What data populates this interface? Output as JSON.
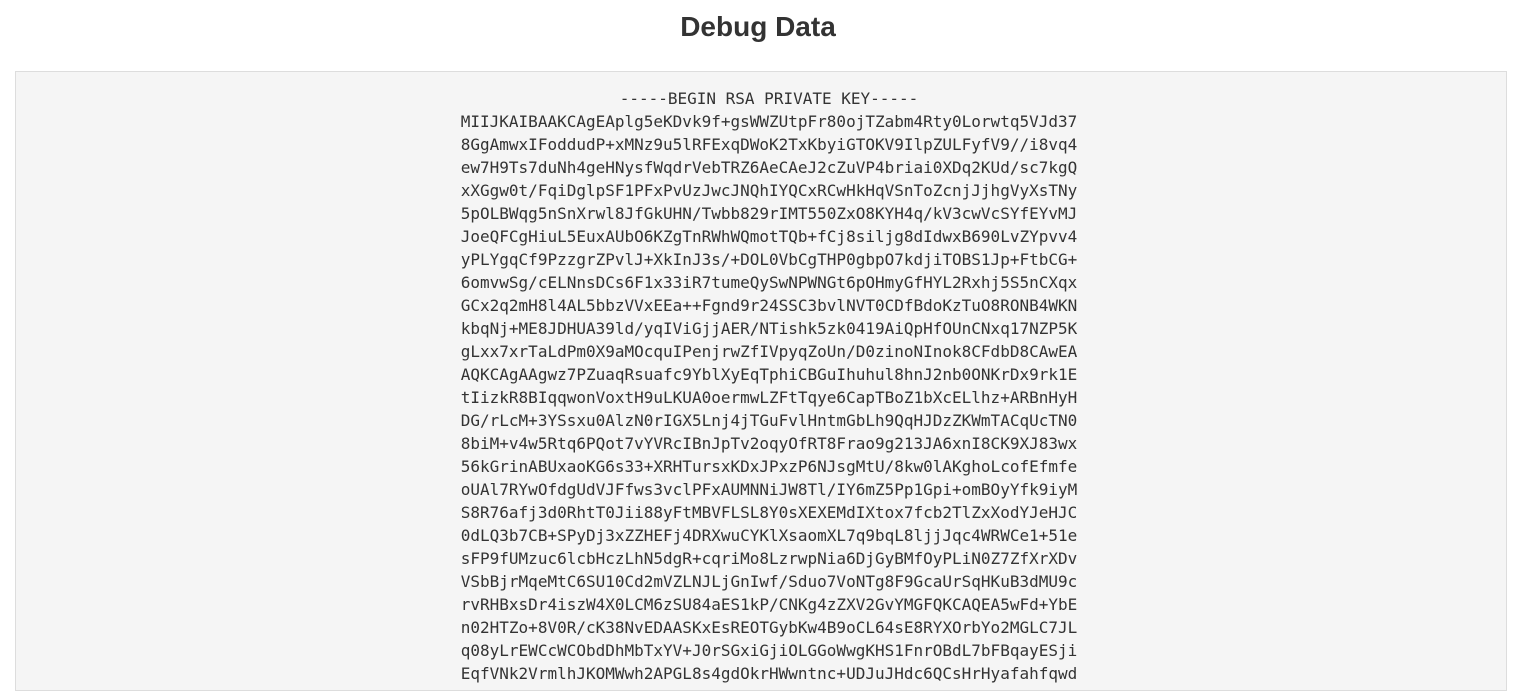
{
  "page": {
    "title": "Debug Data"
  },
  "debug": {
    "header": "-----BEGIN RSA PRIVATE KEY-----",
    "lines": [
      "MIIJKAIBAAKCAgEAplg5eKDvk9f+gsWWZUtpFr80ojTZabm4Rty0Lorwtq5VJd37",
      "8GgAmwxIFoddudP+xMNz9u5lRFExqDWoK2TxKbyiGTOKV9IlpZULFyfV9//i8vq4",
      "ew7H9Ts7duNh4geHNysfWqdrVebTRZ6AeCAeJ2cZuVP4briai0XDq2KUd/sc7kgQ",
      "xXGgw0t/FqiDglpSF1PFxPvUzJwcJNQhIYQCxRCwHkHqVSnToZcnjJjhgVyXsTNy",
      "5pOLBWqg5nSnXrwl8JfGkUHN/Twbb829rIMT550ZxO8KYH4q/kV3cwVcSYfEYvMJ",
      "JoeQFCgHiuL5EuxAUbO6KZgTnRWhWQmotTQb+fCj8siljg8dIdwxB690LvZYpvv4",
      "yPLYgqCf9PzzgrZPvlJ+XkInJ3s/+DOL0VbCgTHP0gbpO7kdjiTOBS1Jp+FtbCG+",
      "6omvwSg/cELNnsDCs6F1x33iR7tumeQySwNPWNGt6pOHmyGfHYL2Rxhj5S5nCXqx",
      "GCx2q2mH8l4AL5bbzVVxEEa++Fgnd9r24SSC3bvlNVT0CDfBdoKzTuO8RONB4WKN",
      "kbqNj+ME8JDHUA39ld/yqIViGjjAER/NTishk5zk0419AiQpHfOUnCNxq17NZP5K",
      "gLxx7xrTaLdPm0X9aMOcquIPenjrwZfIVpyqZoUn/D0zinoNInok8CFdbD8CAwEA",
      "AQKCAgAAgwz7PZuaqRsuafc9YblXyEqTphiCBGuIhuhul8hnJ2nb0ONKrDx9rk1E",
      "tIizkR8BIqqwonVoxtH9uLKUA0oermwLZFtTqye6CapTBoZ1bXcELlhz+ARBnHyH",
      "DG/rLcM+3YSsxu0AlzN0rIGX5Lnj4jTGuFvlHntmGbLh9QqHJDzZKWmTACqUcTN0",
      "8biM+v4w5Rtq6PQot7vYVRcIBnJpTv2oqyOfRT8Frao9g213JA6xnI8CK9XJ83wx",
      "56kGrinABUxaoKG6s33+XRHTursxKDxJPxzP6NJsgMtU/8kw0lAKghoLcofEfmfe",
      "oUAl7RYwOfdgUdVJFfws3vclPFxAUMNNiJW8Tl/IY6mZ5Pp1Gpi+omBOyYfk9iyM",
      "S8R76afj3d0RhtT0Jii88yFtMBVFLSL8Y0sXEXEMdIXtox7fcb2TlZxXodYJeHJC",
      "0dLQ3b7CB+SPyDj3xZZHEFj4DRXwuCYKlXsaomXL7q9bqL8ljjJqc4WRWCe1+51e",
      "sFP9fUMzuc6lcbHczLhN5dgR+cqriMo8LzrwpNia6DjGyBMfOyPLiN0Z7ZfXrXDv",
      "VSbBjrMqeMtC6SU10Cd2mVZLNJLjGnIwf/Sduo7VoNTg8F9GcaUrSqHKuB3dMU9c",
      "rvRHBxsDr4iszW4X0LCM6zSU84aES1kP/CNKg4zZXV2GvYMGFQKCAQEA5wFd+YbE",
      "n02HTZo+8V0R/cK38NvEDAASKxEsREOTGybKw4B9oCL64sE8RYXOrbYo2MGLC7JL",
      "q08yLrEWCcWCObdDhMbTxYV+J0rSGxiGjiOLGGoWwgKHS1FnrOBdL7bFBqayESji",
      "EqfVNk2VrmlhJKOMWwh2APGL8s4gdOkrHWwntnc+UDJuJHdc6QCsHrHyafahfqwd"
    ]
  }
}
